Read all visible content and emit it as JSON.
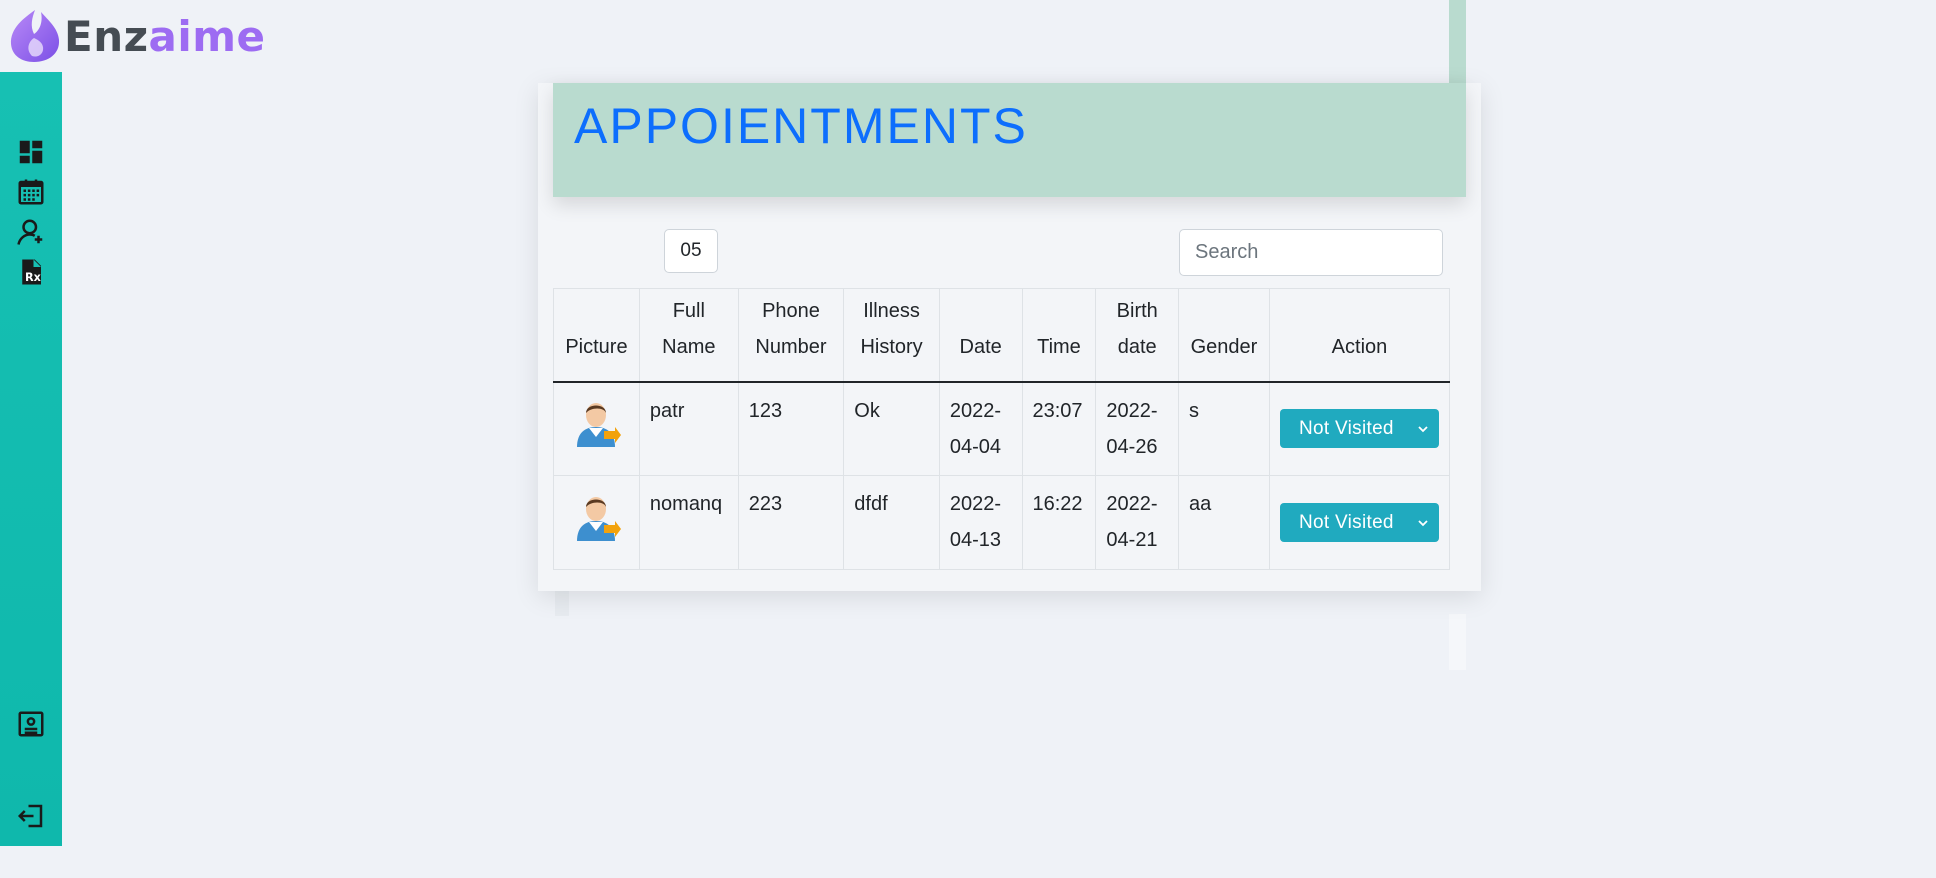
{
  "brand": {
    "name_part1": "Enz",
    "name_part2": "aime",
    "accent": "#9d6cf2"
  },
  "sidebar": {
    "color": "#17c0b3",
    "items": [
      {
        "icon": "dashboard-icon"
      },
      {
        "icon": "calendar-icon"
      },
      {
        "icon": "add-user-icon"
      },
      {
        "icon": "prescription-icon"
      },
      {
        "icon": "contact-card-icon"
      },
      {
        "icon": "logout-icon"
      }
    ]
  },
  "page": {
    "title": "APPOIENTMENTS",
    "title_color": "#0d6efd"
  },
  "controls": {
    "entries_value": "05",
    "search_placeholder": "Search"
  },
  "table": {
    "headers": {
      "picture": "Picture",
      "full_name": [
        "Full",
        "Name"
      ],
      "phone": [
        "Phone",
        "Number"
      ],
      "illness": [
        "Illness",
        "History"
      ],
      "date": "Date",
      "time": "Time",
      "birth": [
        "Birth",
        "date"
      ],
      "gender": "Gender",
      "action": "Action"
    },
    "rows": [
      {
        "name": "patr",
        "phone": "123",
        "illness": "Ok",
        "date": [
          "2022-",
          "04-04"
        ],
        "time": "23:07",
        "birth": [
          "2022-",
          "04-26"
        ],
        "gender": "s",
        "status": "Not Visited"
      },
      {
        "name": "nomanq",
        "phone": "223",
        "illness": "dfdf",
        "date": [
          "2022-",
          "04-13"
        ],
        "time": "16:22",
        "birth": [
          "2022-",
          "04-21"
        ],
        "gender": "aa",
        "status": "Not Visited"
      }
    ]
  },
  "colors": {
    "header_bg": "#b9dbcf",
    "button_bg": "#20aabf",
    "page_bg": "#eff2f7"
  }
}
